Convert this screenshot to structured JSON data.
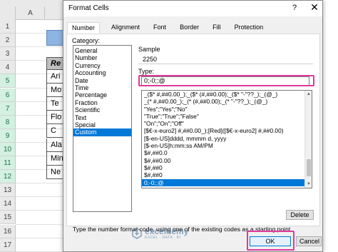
{
  "spreadsheet": {
    "column_header": "A",
    "row_numbers": [
      "1",
      "2",
      "3",
      "4",
      "5",
      "6",
      "7",
      "8",
      "9",
      "10",
      "11",
      "12",
      "13",
      "14",
      "15",
      "16",
      "17"
    ],
    "selected_rows": [
      "5",
      "6",
      "7",
      "8",
      "9",
      "10",
      "11",
      "12"
    ],
    "table_header": "Re",
    "cells": [
      "Ari",
      "Mo",
      "Te",
      "Flo",
      "C",
      "Ala",
      "Minn",
      "Ne"
    ]
  },
  "dialog": {
    "title": "Format Cells",
    "help_label": "?",
    "close_label": "✕",
    "tabs": [
      "Number",
      "Alignment",
      "Font",
      "Border",
      "Fill",
      "Protection"
    ],
    "active_tab": "Number",
    "category_label": "Category:",
    "categories": [
      "General",
      "Number",
      "Currency",
      "Accounting",
      "Date",
      "Time",
      "Percentage",
      "Fraction",
      "Scientific",
      "Text",
      "Special",
      "Custom"
    ],
    "selected_category": "Custom",
    "sample_label": "Sample",
    "sample_value": "2250",
    "type_label": "Type:",
    "type_value": "0;-0;;@",
    "format_codes": [
      "_($* #,##0.00_);_($* (#,##0.00);_($* \"-\"??_);_(@_)",
      "_(* #,##0.00_);_(* (#,##0.00);_(* \"-\"??_);_(@_)",
      "\"Yes\";\"Yes\";\"No\"",
      "\"True\";\"True\";\"False\"",
      "\"On\";\"On\";\"Off\"",
      "[$€-x-euro2] #,##0.00_);[Red]([$€-x-euro2] #,##0.00)",
      "[$-en-US]dddd, mmmm d, yyyy",
      "[$-en-US]h:mm:ss AM/PM",
      "$#,##0.0",
      "$#,##0.00",
      "$#,##0",
      "$#,##0",
      "0;-0;;@"
    ],
    "selected_format": "0;-0;;@",
    "delete_label": "Delete",
    "description": "Type the number format code, using one of the existing codes as a starting point.",
    "ok_label": "OK",
    "cancel_label": "Cancel",
    "accent_color": "#0078d7",
    "highlight_color": "#e0389c"
  },
  "watermark": {
    "name": "exceldemy",
    "tagline": "EXCEL · DATA · BI"
  }
}
